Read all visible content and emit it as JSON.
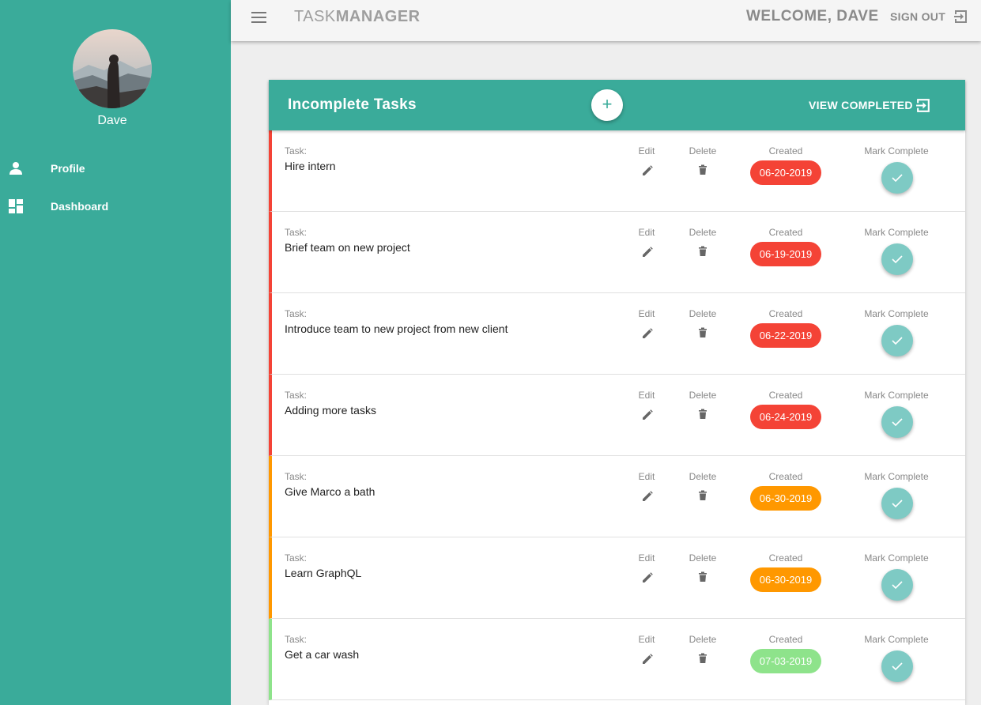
{
  "sidebar": {
    "user_name": "Dave",
    "items": [
      {
        "label": "Profile",
        "icon": "person-icon"
      },
      {
        "label": "Dashboard",
        "icon": "dashboard-icon"
      }
    ]
  },
  "topbar": {
    "brand_part1": "TASK",
    "brand_part2": "MANAGER",
    "welcome": "WELCOME, DAVE",
    "signout": "SIGN OUT"
  },
  "panel": {
    "title": "Incomplete Tasks",
    "add_label": "+",
    "view_completed": "VIEW COMPLETED"
  },
  "columns": {
    "task": "Task:",
    "edit": "Edit",
    "delete": "Delete",
    "created": "Created",
    "mark": "Mark Complete"
  },
  "colors": {
    "accent": "#3aab9a",
    "overdue": "#f44336",
    "soon": "#ff9800",
    "upcoming": "#8ee38b",
    "mark": "#7ecac4"
  },
  "tasks": [
    {
      "text": "Hire intern",
      "date": "06-20-2019",
      "status": "overdue"
    },
    {
      "text": "Brief team on new project",
      "date": "06-19-2019",
      "status": "overdue"
    },
    {
      "text": "Introduce team to new project from new client",
      "date": "06-22-2019",
      "status": "overdue"
    },
    {
      "text": "Adding more tasks",
      "date": "06-24-2019",
      "status": "overdue"
    },
    {
      "text": "Give Marco a bath",
      "date": "06-30-2019",
      "status": "soon"
    },
    {
      "text": "Learn GraphQL",
      "date": "06-30-2019",
      "status": "soon"
    },
    {
      "text": "Get a car wash",
      "date": "07-03-2019",
      "status": "upcoming"
    }
  ]
}
